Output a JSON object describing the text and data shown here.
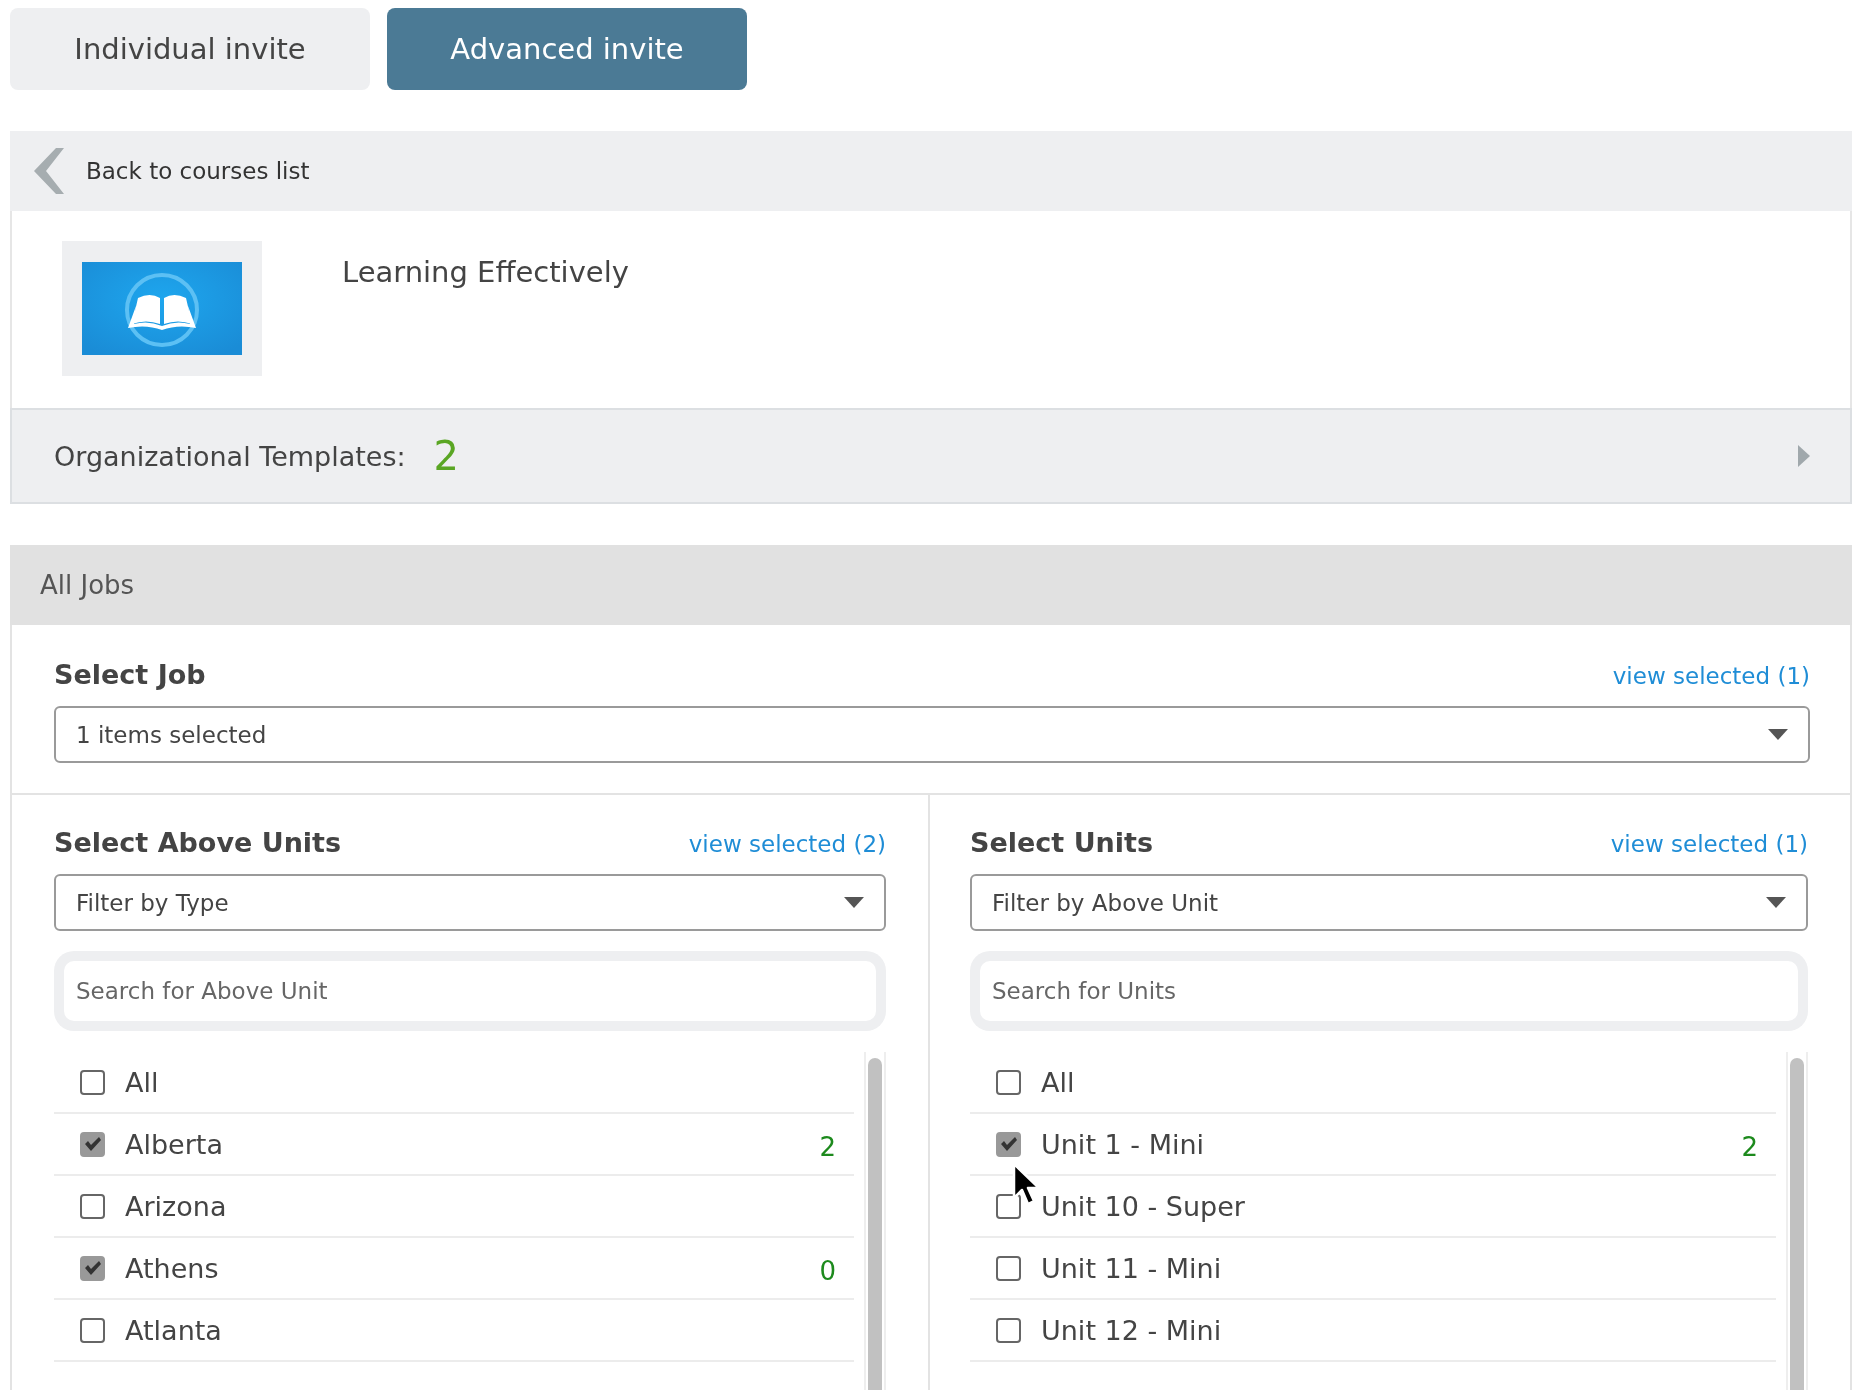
{
  "tabs": [
    {
      "label": "Individual invite",
      "selected": false
    },
    {
      "label": "Advanced invite",
      "selected": true
    }
  ],
  "back_link": "Back to courses list",
  "course": {
    "title": "Learning Effectively"
  },
  "templates": {
    "label": "Organizational Templates:",
    "count": "2"
  },
  "section_title": "All Jobs",
  "job": {
    "label": "Select Job",
    "link": "view selected (1)",
    "dropdown": "1 items selected"
  },
  "columns": [
    {
      "label": "Select Above Units",
      "link": "view selected (2)",
      "filter": "Filter by Type",
      "search_placeholder": "Search for Above Unit",
      "items": [
        {
          "label": "All",
          "checked": false
        },
        {
          "label": "Alberta",
          "checked": true,
          "count": "2"
        },
        {
          "label": "Arizona",
          "checked": false
        },
        {
          "label": "Athens",
          "checked": true,
          "count": "0"
        },
        {
          "label": "Atlanta",
          "checked": false
        }
      ]
    },
    {
      "label": "Select Units",
      "link": "view selected (1)",
      "filter": "Filter by Above Unit",
      "search_placeholder": "Search for Units",
      "items": [
        {
          "label": "All",
          "checked": false
        },
        {
          "label": "Unit 1 - Mini",
          "checked": true,
          "count": "2"
        },
        {
          "label": "Unit 10 - Super",
          "checked": false
        },
        {
          "label": "Unit 11 - Mini",
          "checked": false
        },
        {
          "label": "Unit 12 - Mini",
          "checked": false
        }
      ]
    }
  ]
}
